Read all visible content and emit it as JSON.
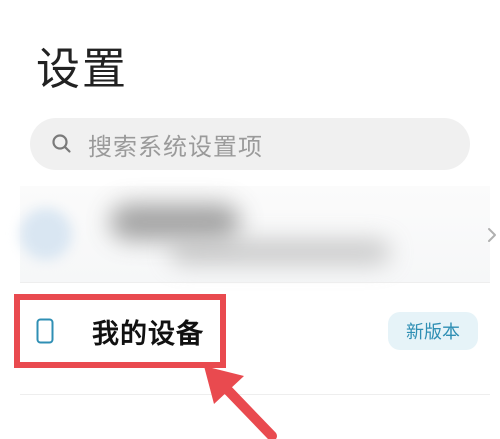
{
  "header": {
    "title": "设置"
  },
  "search": {
    "placeholder": "搜索系统设置项"
  },
  "menu": {
    "device_label": "我的设备",
    "badge": "新版本"
  },
  "icons": {
    "search": "search-icon",
    "chevron": "chevron-right-icon",
    "device": "phone-icon"
  },
  "colors": {
    "highlight": "#e94a4f",
    "badge_bg": "#e6f3f8",
    "badge_text": "#2f8fb4"
  }
}
